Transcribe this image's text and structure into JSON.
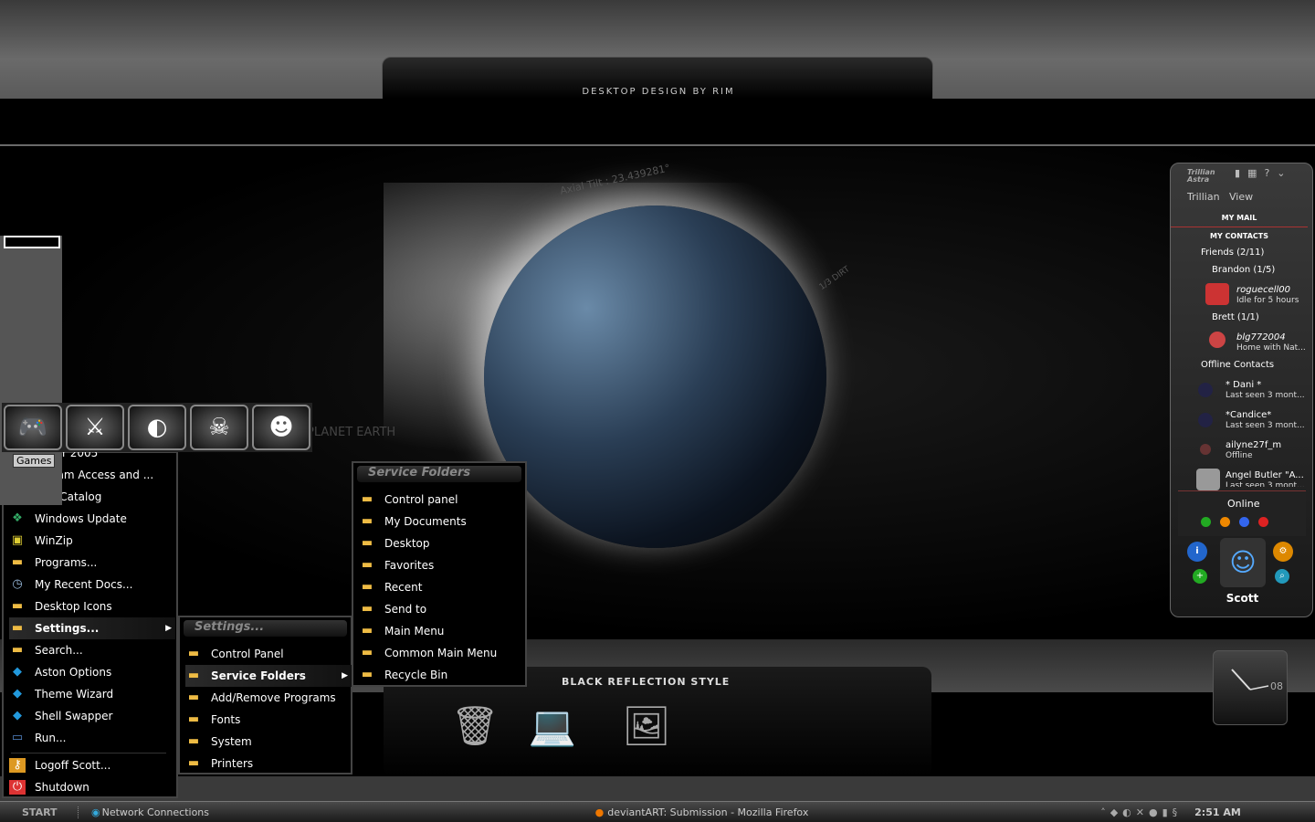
{
  "banner": {
    "title": "DESKTOP DESIGN BY RIM"
  },
  "wallpaper": {
    "axial_tilt": "Axial Tilt : 23.439281°",
    "dirt": "1/3 DIRT",
    "planet": "PLANET EARTH"
  },
  "dock": {
    "title": "BLACK REFLECTION STYLE",
    "icons": [
      "recycle-bin-icon",
      "laptop-icon",
      "photos-icon"
    ]
  },
  "clock": {
    "label": "08"
  },
  "games": {
    "tooltip": "Games",
    "icons": [
      "gamepad-icon",
      "warcraft-icon",
      "half-life-icon",
      "skull-icon",
      "smiley-icon"
    ]
  },
  "start_menu": {
    "items": [
      {
        "label": "ender 2005",
        "icon": "app"
      },
      {
        "label": "rogram Access and ...",
        "icon": "app"
      },
      {
        "label": "ows Catalog",
        "icon": "app"
      },
      {
        "label": "Windows Update",
        "icon": "windows-update"
      },
      {
        "label": "WinZip",
        "icon": "winzip"
      },
      {
        "label": "Programs...",
        "icon": "folder"
      },
      {
        "label": "My Recent Docs...",
        "icon": "recent"
      },
      {
        "label": "Desktop Icons",
        "icon": "folder"
      },
      {
        "label": "Settings...",
        "icon": "folder",
        "highlighted": true
      },
      {
        "label": "Search...",
        "icon": "folder"
      },
      {
        "label": "Aston Options",
        "icon": "aston"
      },
      {
        "label": "Theme Wizard",
        "icon": "aston"
      },
      {
        "label": "Shell Swapper",
        "icon": "aston"
      },
      {
        "label": "Run...",
        "icon": "run"
      }
    ],
    "footer": [
      {
        "label": "Logoff Scott..."
      },
      {
        "label": "Shutdown"
      }
    ]
  },
  "settings_menu": {
    "title": "Settings...",
    "items": [
      {
        "label": "Control Panel"
      },
      {
        "label": "Service Folders",
        "highlighted": true
      },
      {
        "label": "Add/Remove Programs"
      },
      {
        "label": "Fonts"
      },
      {
        "label": "System"
      },
      {
        "label": "Printers"
      }
    ]
  },
  "service_menu": {
    "title": "Service Folders",
    "items": [
      {
        "label": "Control panel"
      },
      {
        "label": "My Documents"
      },
      {
        "label": "Desktop"
      },
      {
        "label": "Favorites"
      },
      {
        "label": "Recent"
      },
      {
        "label": "Send to"
      },
      {
        "label": "Main Menu"
      },
      {
        "label": "Common Main Menu"
      },
      {
        "label": "Recycle Bin"
      }
    ]
  },
  "trillian": {
    "logo": "Trillian Astra",
    "menu": [
      "Trillian",
      "View"
    ],
    "my_mail": "MY MAIL",
    "my_contacts": "MY CONTACTS",
    "groups": {
      "friends": "Friends (2/11)",
      "brandon": "Brandon (1/5)",
      "brett": "Brett (1/1)",
      "offline": "Offline Contacts"
    },
    "contacts": [
      {
        "name": "roguecell00",
        "status": "Idle for 5 hours"
      },
      {
        "name": "blg772004",
        "status": "Home with Nat..."
      },
      {
        "name": "* Dani *",
        "status": "Last seen 3 mont..."
      },
      {
        "name": "*Candice*",
        "status": "Last seen 3 mont..."
      },
      {
        "name": "ailyne27f_m",
        "status": "Offline"
      },
      {
        "name": "Angel Butler \"A...",
        "status": "Last seen 3 mont..."
      }
    ],
    "status": "Online",
    "user": "Scott",
    "status_colors": [
      "#2a2",
      "#e80",
      "#36e",
      "#d22"
    ]
  },
  "taskbar": {
    "start": "START",
    "tasks": [
      "Network Connections",
      "deviantART: Submission - Mozilla Firefox"
    ],
    "time": "2:51 AM"
  }
}
